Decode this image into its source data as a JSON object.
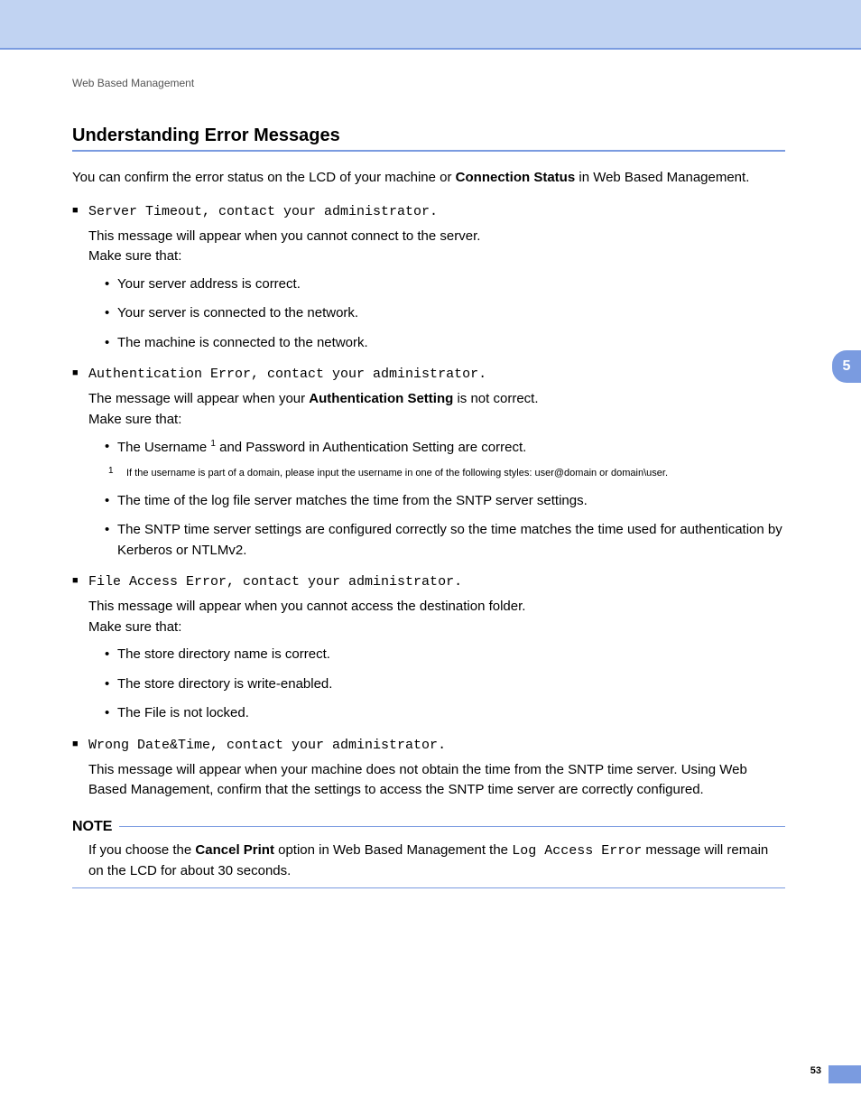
{
  "breadcrumb": "Web Based Management",
  "heading": "Understanding Error Messages",
  "intro_before": "You can confirm the error status on the LCD of your machine or ",
  "intro_bold": "Connection Status",
  "intro_after": " in Web Based Management.",
  "errors": [
    {
      "title": "Server Timeout, contact your administrator.",
      "desc1": "This message will appear when you cannot connect to the server.",
      "desc2": "Make sure that:",
      "items": [
        "Your server address is correct.",
        "Your server is connected to the network.",
        "The machine is connected to the network."
      ]
    },
    {
      "title": "Authentication Error, contact your administrator.",
      "desc1_before": "The message will appear when your ",
      "desc1_bold": "Authentication Setting",
      "desc1_after": " is not correct.",
      "desc2": "Make sure that:",
      "item1_before": "The Username ",
      "item1_sup": "1",
      "item1_after": " and Password in Authentication Setting are correct.",
      "footnote_num": "1",
      "footnote": "If the username is part of a domain, please input the username in one of the following styles: user@domain or domain\\user.",
      "item2": "The time of the log file server matches the time from the SNTP server settings.",
      "item3": "The SNTP time server settings are configured correctly so the time matches the time used for authentication by Kerberos or NTLMv2."
    },
    {
      "title": "File Access Error, contact your administrator.",
      "desc1": "This message will appear when you cannot access the destination folder.",
      "desc2": "Make sure that:",
      "items": [
        "The store directory name is correct.",
        "The store directory is write-enabled.",
        "The File is not locked."
      ]
    },
    {
      "title": "Wrong Date&Time, contact your administrator.",
      "desc1": "This message will appear when your machine does not obtain the time from the SNTP time server. Using Web Based Management, confirm that the settings to access the SNTP time server are correctly configured."
    }
  ],
  "note_label": "NOTE",
  "note_before": "If you choose the ",
  "note_bold": "Cancel Print",
  "note_mid": " option in Web Based Management the ",
  "note_mono": "Log Access Error",
  "note_after": " message will remain on the LCD for about 30 seconds.",
  "chapter_tab": "5",
  "page_number": "53"
}
